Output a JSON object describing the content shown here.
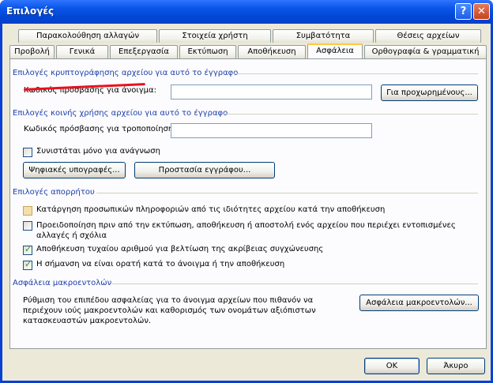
{
  "window": {
    "title": "Επιλογές",
    "help_label": "?",
    "close_label": "✕"
  },
  "tabs": {
    "row1": [
      "Παρακολούθηση αλλαγών",
      "Στοιχεία χρήστη",
      "Συμβατότητα",
      "Θέσεις αρχείων"
    ],
    "row2": [
      "Προβολή",
      "Γενικά",
      "Επεξεργασία",
      "Εκτύπωση",
      "Αποθήκευση",
      "Ασφάλεια",
      "Ορθογραφία & γραμματική"
    ],
    "selected": "Ασφάλεια"
  },
  "encryption": {
    "heading": "Επιλογές κρυπτογράφησης αρχείου για αυτό το έγγραφο",
    "open_password_label": "Κωδικός πρόσβασης για άνοιγμα:",
    "open_password_value": "",
    "advanced_button": "Για προχωρημένους..."
  },
  "sharing": {
    "heading": "Επιλογές κοινής χρήσης αρχείου για αυτό το έγγραφο",
    "modify_password_label": "Κωδικός πρόσβασης για τροποποίηση:",
    "modify_password_value": "",
    "readonly_label": "Συνιστάται μόνο για ανάγνωση",
    "readonly_checked": false,
    "signatures_button": "Ψηφιακές υπογραφές...",
    "protect_button": "Προστασία εγγράφου..."
  },
  "privacy": {
    "heading": "Επιλογές απορρήτου",
    "items": [
      {
        "label": "Κατάργηση προσωπικών πληροφοριών από τις ιδιότητες αρχείου κατά την αποθήκευση",
        "checked": false
      },
      {
        "label": "Προειδοποίηση πριν από την εκτύπωση, αποθήκευση ή αποστολή ενός αρχείου που περιέχει εντοπισμένες αλλαγές ή σχόλια",
        "checked": false
      },
      {
        "label": "Αποθήκευση τυχαίου αριθμού για βελτίωση της ακρίβειας συγχώνευσης",
        "checked": true
      },
      {
        "label": "Η σήμανση να είναι ορατή κατά το άνοιγμα ή την αποθήκευση",
        "checked": true
      }
    ]
  },
  "macro": {
    "heading": "Ασφάλεια μακροεντολών",
    "description": "Ρύθμιση του επιπέδου ασφαλείας για το άνοιγμα αρχείων που πιθανόν να περιέχουν ιούς μακροεντολών και καθορισμός των ονομάτων αξιόπιστων κατασκευαστών μακροεντολών.",
    "button": "Ασφάλεια μακροεντολών..."
  },
  "footer": {
    "ok": "OK",
    "cancel": "Άκυρο"
  },
  "colors": {
    "title_bar": "#0a55e8",
    "section_heading": "#1c3ea8",
    "annotation": "#e8111c",
    "selected_tab_accent": "#ffc83c"
  }
}
